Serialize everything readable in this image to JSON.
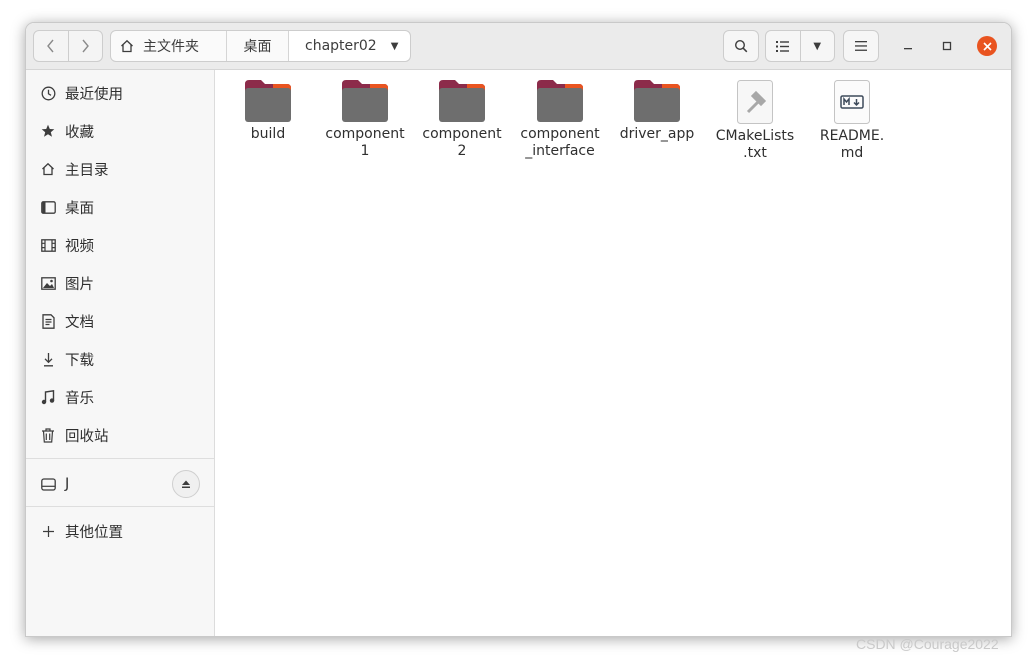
{
  "header": {
    "path": [
      {
        "label": "主文件夹"
      },
      {
        "label": "桌面"
      },
      {
        "label": "chapter02"
      }
    ],
    "back_icon": "chevron-left-icon",
    "forward_icon": "chevron-right-icon",
    "search_icon": "search-icon",
    "view_icon": "list-view-icon",
    "menu_icon": "hamburger-menu-icon"
  },
  "sidebar": {
    "items": [
      {
        "label": "最近使用",
        "icon": "clock-icon"
      },
      {
        "label": "收藏",
        "icon": "star-icon"
      },
      {
        "label": "主目录",
        "icon": "home-icon"
      },
      {
        "label": "桌面",
        "icon": "desktop-icon"
      },
      {
        "label": "视频",
        "icon": "video-icon"
      },
      {
        "label": "图片",
        "icon": "picture-icon"
      },
      {
        "label": "文档",
        "icon": "document-icon"
      },
      {
        "label": "下载",
        "icon": "download-icon"
      },
      {
        "label": "音乐",
        "icon": "music-icon"
      },
      {
        "label": "回收站",
        "icon": "trash-icon"
      }
    ],
    "devices": [
      {
        "label": "J",
        "icon": "drive-icon"
      }
    ],
    "other": {
      "label": "其他位置",
      "icon": "plus-icon"
    }
  },
  "files": [
    {
      "name": "build",
      "type": "folder"
    },
    {
      "name": "component\n1",
      "type": "folder"
    },
    {
      "name": "component\n2",
      "type": "folder"
    },
    {
      "name": "component\n_interface",
      "type": "folder"
    },
    {
      "name": "driver_app",
      "type": "folder"
    },
    {
      "name": "CMakeLists\n.txt",
      "type": "cmake"
    },
    {
      "name": "README.\nmd",
      "type": "markdown"
    }
  ],
  "watermark": "CSDN @Courage2022",
  "colors": {
    "accent": "#e95420",
    "folder_body": "#6e6e6e",
    "folder_tab": "#8c2b4a"
  }
}
